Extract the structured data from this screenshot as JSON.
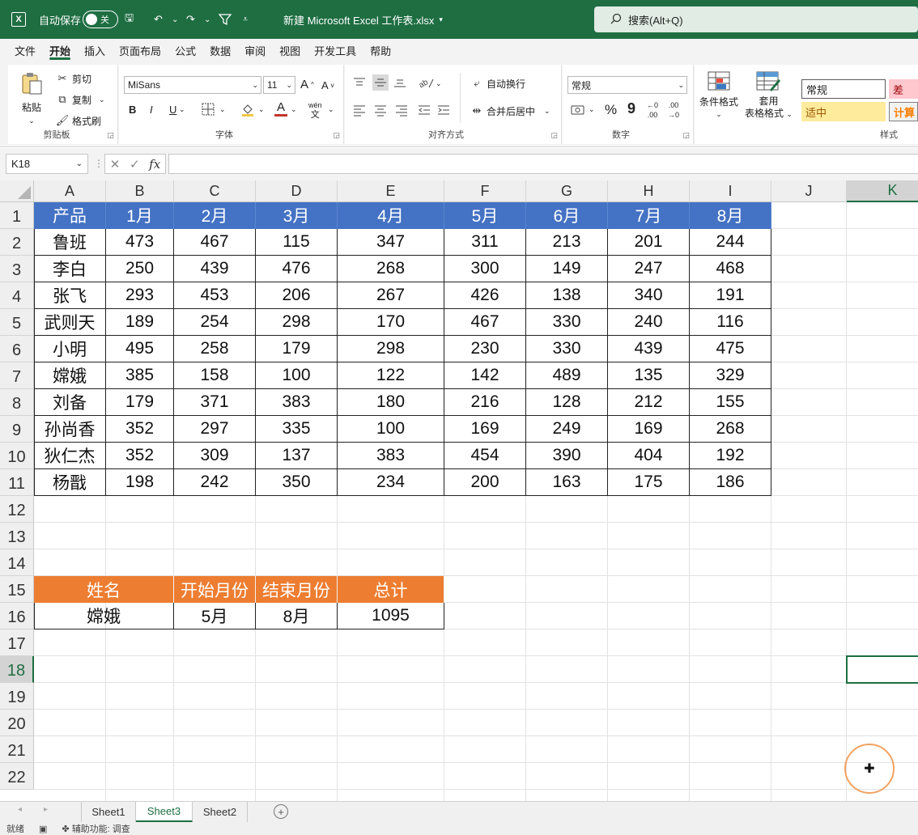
{
  "titlebar": {
    "autosave_label": "自动保存",
    "autosave_state": "关",
    "filename": "新建 Microsoft Excel 工作表.xlsx",
    "search_placeholder": "搜索(Alt+Q)"
  },
  "menu": {
    "tabs": [
      "文件",
      "开始",
      "插入",
      "页面布局",
      "公式",
      "数据",
      "审阅",
      "视图",
      "开发工具",
      "帮助"
    ],
    "active": "开始"
  },
  "ribbon": {
    "clipboard": {
      "paste": "粘贴",
      "cut": "剪切",
      "copy": "复制",
      "format_painter": "格式刷",
      "label": "剪贴板"
    },
    "font": {
      "name": "MiSans",
      "size": "11",
      "label": "字体",
      "bold": "B",
      "italic": "I",
      "underline": "U"
    },
    "alignment": {
      "wrap": "自动换行",
      "merge": "合并后居中",
      "label": "对齐方式"
    },
    "number": {
      "format": "常规",
      "label": "数字"
    },
    "styles": {
      "conditional": "条件格式",
      "table_format_1": "套用",
      "table_format_2": "表格格式",
      "normal": "常规",
      "bad": "差",
      "neutral": "适中",
      "calc": "计算",
      "label": "样式"
    }
  },
  "formula_bar": {
    "namebox": "K18",
    "fx": "fx",
    "formula": ""
  },
  "grid": {
    "columns": [
      "A",
      "B",
      "C",
      "D",
      "E",
      "F",
      "G",
      "H",
      "I",
      "J",
      "K"
    ],
    "rows": [
      "1",
      "2",
      "3",
      "4",
      "5",
      "6",
      "7",
      "8",
      "9",
      "10",
      "11",
      "12",
      "13",
      "14",
      "15",
      "16",
      "17",
      "18",
      "19",
      "20",
      "21",
      "22"
    ],
    "selected_col": "K",
    "selected_row": "18"
  },
  "table1": {
    "header": [
      "产品",
      "1月",
      "2月",
      "3月",
      "4月",
      "5月",
      "6月",
      "7月",
      "8月"
    ],
    "rows": [
      [
        "鲁班",
        "473",
        "467",
        "115",
        "347",
        "311",
        "213",
        "201",
        "244"
      ],
      [
        "李白",
        "250",
        "439",
        "476",
        "268",
        "300",
        "149",
        "247",
        "468"
      ],
      [
        "张飞",
        "293",
        "453",
        "206",
        "267",
        "426",
        "138",
        "340",
        "191"
      ],
      [
        "武则天",
        "189",
        "254",
        "298",
        "170",
        "467",
        "330",
        "240",
        "116"
      ],
      [
        "小明",
        "495",
        "258",
        "179",
        "298",
        "230",
        "330",
        "439",
        "475"
      ],
      [
        "嫦娥",
        "385",
        "158",
        "100",
        "122",
        "142",
        "489",
        "135",
        "329"
      ],
      [
        "刘备",
        "179",
        "371",
        "383",
        "180",
        "216",
        "128",
        "212",
        "155"
      ],
      [
        "孙尚香",
        "352",
        "297",
        "335",
        "100",
        "169",
        "249",
        "169",
        "268"
      ],
      [
        "狄仁杰",
        "352",
        "309",
        "137",
        "383",
        "454",
        "390",
        "404",
        "192"
      ],
      [
        "杨戬",
        "198",
        "242",
        "350",
        "234",
        "200",
        "163",
        "175",
        "186"
      ]
    ]
  },
  "table2": {
    "header": [
      "姓名",
      "开始月份",
      "结束月份",
      "总计"
    ],
    "row": [
      "嫦娥",
      "5月",
      "8月",
      "1095"
    ]
  },
  "sheets": {
    "tabs": [
      "Sheet1",
      "Sheet3",
      "Sheet2"
    ],
    "active": "Sheet3"
  },
  "status": {
    "ready": "就绪",
    "accessibility": "辅助功能: 调查"
  },
  "colors": {
    "brand": "#1e6e42",
    "table_header_blue": "#4472c4",
    "table_header_orange": "#ed7d31"
  }
}
